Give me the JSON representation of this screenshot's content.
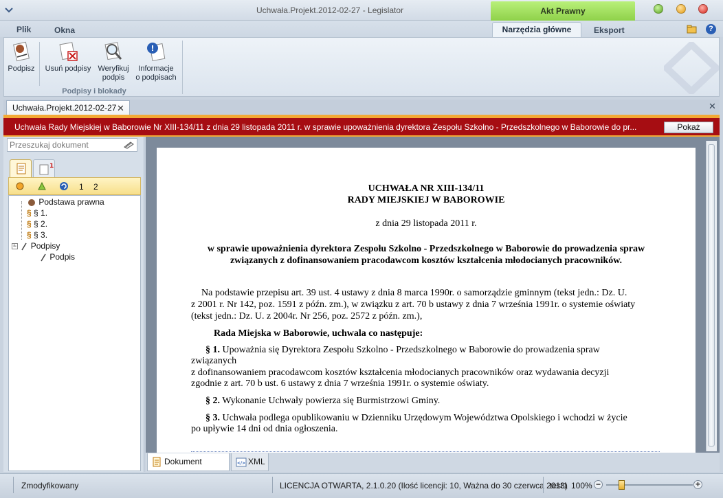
{
  "window": {
    "title": "Uchwała.Projekt.2012-02-27 - Legislator",
    "context_tab": "Akt Prawny"
  },
  "menu": {
    "plik": "Plik",
    "okna": "Okna",
    "tabs": [
      "Narzędzia główne",
      "Eksport"
    ],
    "help_label": "?"
  },
  "ribbon": {
    "buttons": [
      {
        "label1": "Podpisz",
        "label2": ""
      },
      {
        "label1": "Usuń podpisy",
        "label2": ""
      },
      {
        "label1": "Weryfikuj",
        "label2": "podpis"
      },
      {
        "label1": "Informacje",
        "label2": "o podpisach"
      }
    ],
    "group_label": "Podpisy i blokady"
  },
  "doc_tab": {
    "title": "Uchwała.Projekt.2012-02-27",
    "close": "✕",
    "strip_close": "✕"
  },
  "header_bar": {
    "text": "Uchwała Rady Miejskiej w Baborowie Nr XIII-134/11 z dnia 29 listopada 2011 r. w sprawie upoważnienia dyrektora Zespołu Szkolno - Przedszkolnego w Baborowie do pr...",
    "button": "Pokaż"
  },
  "sidebar": {
    "search_placeholder": "Przeszukaj dokument",
    "toolbar_nums": [
      "1",
      "2"
    ],
    "tree": [
      {
        "label": "Podstawa prawna"
      },
      {
        "label": "§ 1."
      },
      {
        "label": "§ 2."
      },
      {
        "label": "§ 3."
      },
      {
        "label": "Podpisy"
      },
      {
        "label": "Podpis"
      }
    ]
  },
  "document": {
    "title1": "UCHWAŁA NR XIII-134/11",
    "title2": "RADY MIEJSKIEJ W BABOROWIE",
    "date": "z dnia 29 listopada 2011 r.",
    "subject1": "w sprawie upoważnienia dyrektora Zespołu Szkolno - Przedszkolnego w Baborowie do prowadzenia spraw",
    "subject2": "związanych z dofinansowaniem pracodawcom kosztów kształcenia młodocianych pracowników.",
    "basis_l1": "Na podstawie przepisu art. 39 ust. 4 ustawy z dnia 8 marca 1990r. o samorządzie gminnym (tekst jedn.: Dz. U.",
    "basis_l2": "z 2001 r. Nr 142, poz. 1591 z późn. zm.), w związku z art. 70 b ustawy z dnia 7 września 1991r. o systemie oświaty",
    "basis_l3": "(tekst jedn.: Dz. U. z 2004r. Nr 256, poz. 2572 z późn. zm.),",
    "resolves": "Rada Miejska w Baborowie, uchwala co następuje:",
    "p1_mark": "§ 1.",
    "p1_l1": "Upoważnia się Dyrektora Zespołu Szkolno - Przedszkolnego w Baborowie do prowadzenia spraw",
    "p1_l2": "związanych",
    "p1_l3": "z dofinansowaniem pracodawcom kosztów kształcenia młodocianych pracowników oraz wydawania decyzji",
    "p1_l4": "zgodnie z art. 70 b ust. 6 ustawy z dnia 7 września 1991r. o systemie oświaty.",
    "p2_mark": "§ 2.",
    "p2_text": "Wykonanie Uchwały powierza się Burmistrzowi Gminy.",
    "p3_mark": "§ 3.",
    "p3_l1": "Uchwała podlega opublikowaniu w Dzienniku Urzędowym Województwa Opolskiego i wchodzi w życie",
    "p3_l2": "po upływie 14 dni od dnia ogłoszenia."
  },
  "view_tabs": {
    "dokument": "Dokument główny",
    "xml": "XML"
  },
  "status": {
    "state": "Zmodyfikowany",
    "license": "LICENCJA OTWARTA, 2.1.0.20 (Ilość licencji: 10, Ważna do 30 czerwca 2013)",
    "user": "test1",
    "zoom": "100%",
    "zoom_level_percent": 100,
    "zoom_minus": "−",
    "zoom_plus": "+"
  },
  "colors": {
    "header_bar": "#a60d12",
    "accent_orange": "#f3a935",
    "context_tab_green": "#8fd14a"
  }
}
